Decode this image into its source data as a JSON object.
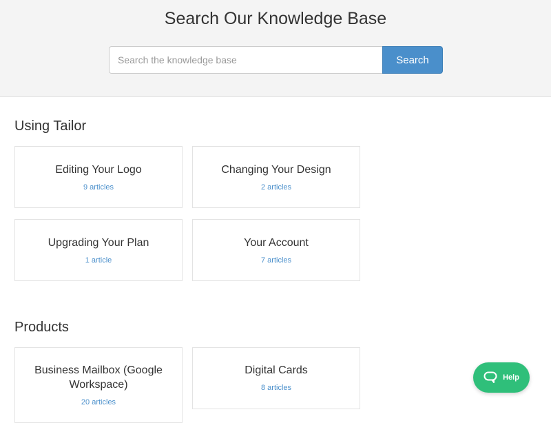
{
  "hero": {
    "title": "Search Our Knowledge Base",
    "search_placeholder": "Search the knowledge base",
    "search_button_label": "Search"
  },
  "sections": [
    {
      "title": "Using Tailor",
      "cards": [
        {
          "title": "Editing Your Logo",
          "count": "9 articles"
        },
        {
          "title": "Changing Your Design",
          "count": "2 articles"
        },
        {
          "title": "Upgrading Your Plan",
          "count": "1 article"
        },
        {
          "title": "Your Account",
          "count": "7 articles"
        }
      ]
    },
    {
      "title": "Products",
      "cards": [
        {
          "title": "Business Mailbox (Google Workspace)",
          "count": "20 articles"
        },
        {
          "title": "Digital Cards",
          "count": "8 articles"
        }
      ]
    }
  ],
  "help_widget": {
    "label": "Help",
    "icon": "chat-bubble-icon",
    "color": "#2fbf7a"
  },
  "colors": {
    "accent": "#4a8fcb",
    "hero_background": "#f4f4f4"
  }
}
